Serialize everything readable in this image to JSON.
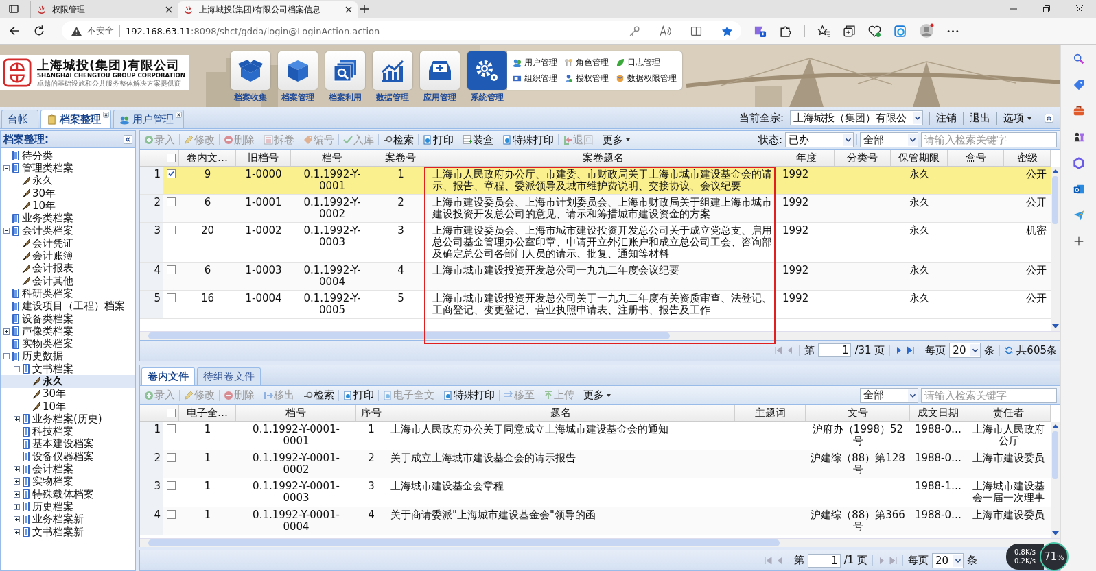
{
  "browser": {
    "tabs": [
      {
        "title": "权限管理",
        "selected": false
      },
      {
        "title": "上海城投(集团)有限公司档案信息",
        "selected": true
      }
    ],
    "security": "不安全",
    "url_host": "192.168.63.11",
    "url_path": ":8098/shct/gdda/login@LoginAction.action"
  },
  "header": {
    "company": "上海城投(集团)有限公司",
    "company_en": "SHANGHAI CHENGTOU GROUP CORPORATION",
    "slogan": "卓越的基础设施和公共服务整体解决方案提供商",
    "modules": [
      {
        "label": "档案收集",
        "kind": "open-box",
        "selected": false
      },
      {
        "label": "档案管理",
        "kind": "box",
        "selected": false
      },
      {
        "label": "档案利用",
        "kind": "search",
        "selected": false
      },
      {
        "label": "数据管理",
        "kind": "chart",
        "selected": false
      },
      {
        "label": "应用管理",
        "kind": "tray",
        "selected": false
      },
      {
        "label": "系统管理",
        "kind": "gear",
        "selected": true
      }
    ],
    "submenu": [
      {
        "label": "用户管理",
        "kind": "users"
      },
      {
        "label": "角色管理",
        "kind": "keys"
      },
      {
        "label": "日志管理",
        "kind": "leaf"
      },
      {
        "label": "组织管理",
        "kind": "card"
      },
      {
        "label": "授权管理",
        "kind": "person"
      },
      {
        "label": "数据权限管理",
        "kind": "cube"
      }
    ]
  },
  "app_tabs": [
    {
      "label": "台帐",
      "closable": false,
      "selected": false
    },
    {
      "label": "档案整理",
      "closable": true,
      "selected": true
    },
    {
      "label": "用户管理",
      "closable": true,
      "selected": false
    }
  ],
  "fonds": {
    "label": "当前全宗:",
    "value": "上海城投（集团）有限公"
  },
  "top_links": [
    "注销",
    "退出"
  ],
  "options": "选项",
  "tree": {
    "title": "档案整理:",
    "items": [
      {
        "label": "待分类",
        "kind": "category",
        "selected": false
      },
      {
        "label": "管理类档案",
        "kind": "category",
        "expanded": true,
        "selected": false,
        "children": [
          {
            "label": "永久",
            "kind": "term",
            "selected": false
          },
          {
            "label": "30年",
            "kind": "term",
            "selected": false
          },
          {
            "label": "10年",
            "kind": "term",
            "selected": false
          }
        ]
      },
      {
        "label": "业务类档案",
        "kind": "category",
        "selected": false
      },
      {
        "label": "会计类档案",
        "kind": "category",
        "expanded": true,
        "selected": false,
        "children": [
          {
            "label": "会计凭证",
            "kind": "term",
            "selected": false
          },
          {
            "label": "会计账簿",
            "kind": "term",
            "selected": false
          },
          {
            "label": "会计报表",
            "kind": "term",
            "selected": false
          },
          {
            "label": "会计其他",
            "kind": "term",
            "selected": false
          }
        ]
      },
      {
        "label": "科研类档案",
        "kind": "category",
        "selected": false
      },
      {
        "label": "建设项目（工程）档案",
        "kind": "category",
        "selected": false
      },
      {
        "label": "设备类档案",
        "kind": "category",
        "selected": false
      },
      {
        "label": "声像类档案",
        "kind": "category",
        "expanded": false,
        "selected": false
      },
      {
        "label": "实物类档案",
        "kind": "category",
        "selected": false
      },
      {
        "label": "历史数据",
        "kind": "category",
        "expanded": true,
        "selected": false,
        "children": [
          {
            "label": "文书档案",
            "kind": "category",
            "expanded": true,
            "selected": false,
            "children": [
              {
                "label": "永久",
                "kind": "term",
                "selected": true
              },
              {
                "label": "30年",
                "kind": "term",
                "selected": false
              },
              {
                "label": "10年",
                "kind": "term",
                "selected": false
              }
            ]
          },
          {
            "label": "业务档案(历史)",
            "kind": "category",
            "expanded": false,
            "selected": false
          },
          {
            "label": "科技档案",
            "kind": "category",
            "selected": false
          },
          {
            "label": "基本建设档案",
            "kind": "category",
            "selected": false
          },
          {
            "label": "设备仪器档案",
            "kind": "category",
            "selected": false
          },
          {
            "label": "会计档案",
            "kind": "category",
            "expanded": false,
            "selected": false
          },
          {
            "label": "实物档案",
            "kind": "category",
            "expanded": false,
            "selected": false
          },
          {
            "label": "特殊载体档案",
            "kind": "category",
            "expanded": false,
            "selected": false
          },
          {
            "label": "历史档案",
            "kind": "category",
            "expanded": false,
            "selected": false
          },
          {
            "label": "业务档案新",
            "kind": "category",
            "expanded": false,
            "selected": false
          },
          {
            "label": "文书档案新",
            "kind": "category",
            "expanded": false,
            "selected": false
          }
        ]
      }
    ]
  },
  "upper": {
    "toolbar": [
      {
        "label": "录入",
        "kind": "add",
        "disabled": true
      },
      {
        "label": "修改",
        "kind": "edit",
        "disabled": true
      },
      {
        "label": "删除",
        "kind": "delete",
        "disabled": true
      },
      {
        "label": "拆卷",
        "kind": "split",
        "disabled": true
      },
      {
        "label": "编号",
        "kind": "number",
        "disabled": true
      },
      {
        "label": "入库",
        "kind": "stock",
        "disabled": true
      },
      {
        "label": "检索",
        "kind": "search",
        "disabled": false
      },
      {
        "label": "打印",
        "kind": "print",
        "disabled": false
      },
      {
        "label": "装盒",
        "kind": "box",
        "disabled": false
      },
      {
        "label": "特殊打印",
        "kind": "print",
        "disabled": false
      },
      {
        "label": "退回",
        "kind": "return",
        "disabled": true
      },
      {
        "label": "更多",
        "kind": "menu",
        "disabled": false
      }
    ],
    "status_label": "状态:",
    "status": "已办",
    "scope": "全部",
    "search_placeholder": "请输入检索关键字",
    "all_checked": false,
    "columns": [
      "卷内文…",
      "旧档号",
      "档号",
      "案卷号",
      "案卷题名",
      "年度",
      "分类号",
      "保管期限",
      "盒号",
      "密级"
    ],
    "rows": [
      {
        "n": "1",
        "checked": true,
        "selected": true,
        "count": "9",
        "old_no": "1-0000",
        "file_no": "0.1.1992-Y-0001",
        "vol_no": "1",
        "title": "上海市人民政府办公厅、市建委、市财政局关于上海市城市建设基金会的请示、报告、章程、委派领导及城市维护费说明、交接协议、会议纪要",
        "year": "1992",
        "retention": "永久",
        "secrecy": "公开"
      },
      {
        "n": "2",
        "checked": false,
        "selected": false,
        "count": "6",
        "old_no": "1-0001",
        "file_no": "0.1.1992-Y-0002",
        "vol_no": "2",
        "title": "上海市建设委员会、上海市计划委员会、上海市财政局关于组建上海市城市建设投资开发总公司的意见、请示和筹措城市建设资金的方案",
        "year": "1992",
        "retention": "永久",
        "secrecy": "公开"
      },
      {
        "n": "3",
        "checked": false,
        "selected": false,
        "count": "20",
        "old_no": "1-0002",
        "file_no": "0.1.1992-Y-0003",
        "vol_no": "3",
        "title": "上海市建设委员会、上海市城市建设投资开发总公司关于成立党总支、启用总公司基金管理办公室印章、申请开立外汇账户和成立总公司工会、咨询部及确定总公司各部门人员的请示、批复、通知等材料",
        "year": "1992",
        "retention": "永久",
        "secrecy": "机密"
      },
      {
        "n": "4",
        "checked": false,
        "selected": false,
        "count": "6",
        "old_no": "1-0003",
        "file_no": "0.1.1992-Y-0004",
        "vol_no": "4",
        "title": "上海市城市建设投资开发总公司一九九二年度会议纪要",
        "year": "1992",
        "retention": "永久",
        "secrecy": "公开"
      },
      {
        "n": "5",
        "checked": false,
        "selected": false,
        "count": "16",
        "old_no": "1-0004",
        "file_no": "0.1.1992-Y-0005",
        "vol_no": "5",
        "title": "上海市城市建设投资开发总公司关于一九九二年度有关资质审查、法登记、工商登记、变更登记、营业执照申请表、注册书、报告及工作",
        "year": "1992",
        "retention": "永久",
        "secrecy": "公开"
      }
    ],
    "pager": {
      "page_label": "第",
      "page": "1",
      "total_pages": "/31 页",
      "per_page_label": "每页",
      "per_page": "20",
      "unit": "条",
      "total": "共605条"
    }
  },
  "lower": {
    "tabs": [
      {
        "label": "卷内文件",
        "selected": true
      },
      {
        "label": "待组卷文件",
        "selected": false
      }
    ],
    "toolbar": [
      {
        "label": "录入",
        "kind": "add",
        "disabled": true
      },
      {
        "label": "修改",
        "kind": "edit",
        "disabled": true
      },
      {
        "label": "删除",
        "kind": "delete",
        "disabled": true
      },
      {
        "label": "移出",
        "kind": "move-out",
        "disabled": true
      },
      {
        "label": "检索",
        "kind": "search",
        "disabled": false
      },
      {
        "label": "打印",
        "kind": "print",
        "disabled": false
      },
      {
        "label": "电子全文",
        "kind": "fulltext",
        "disabled": true
      },
      {
        "label": "特殊打印",
        "kind": "print",
        "disabled": false
      },
      {
        "label": "移至",
        "kind": "move-to",
        "disabled": true
      },
      {
        "label": "上传",
        "kind": "upload",
        "disabled": true
      },
      {
        "label": "更多",
        "kind": "menu",
        "disabled": false
      }
    ],
    "scope": "全部",
    "search_placeholder": "请输入检索关键字",
    "all_checked": false,
    "columns": [
      "电子全…",
      "档号",
      "序号",
      "题名",
      "主题词",
      "文号",
      "成文日期",
      "责任者"
    ],
    "rows": [
      {
        "n": "1",
        "checked": false,
        "selected": false,
        "efile": "1",
        "file_no": "0.1.1992-Y-0001-0001",
        "seq": "1",
        "title": "上海市人民政府办公关于同意成立上海城市建设基金会的通知",
        "doc_no": "沪府办（1998）52号",
        "date": "1988-0…",
        "author": "上海市人民政府公厅"
      },
      {
        "n": "2",
        "checked": false,
        "selected": false,
        "efile": "1",
        "file_no": "0.1.1992-Y-0001-0002",
        "seq": "2",
        "title": "关于成立上海城市建设基金会的请示报告",
        "doc_no": "沪建综（88）第128号",
        "date": "1988-0…",
        "author": "上海市建设委员"
      },
      {
        "n": "3",
        "checked": false,
        "selected": false,
        "efile": "1",
        "file_no": "0.1.1992-Y-0001-0003",
        "seq": "3",
        "title": "上海城市建设基金会章程",
        "date": "1988-1…",
        "author": "上海城市建设基会一届一次理事"
      },
      {
        "n": "4",
        "checked": false,
        "selected": false,
        "efile": "1",
        "file_no": "0.1.1992-Y-0001-0004",
        "seq": "4",
        "title": "关于商请委派\"上海城市建设基金会\"领导的函",
        "doc_no": "沪建综（88）第366号",
        "date": "1988-0…",
        "author": "上海市建设委员"
      }
    ],
    "pager": {
      "page_label": "第",
      "page": "1",
      "total_pages": "/1 页",
      "per_page_label": "每页",
      "per_page": "20",
      "unit": "条"
    }
  },
  "net_widget": {
    "up": "0.8K/s",
    "down": "0.2K/s",
    "percent": "71",
    "unit": "%"
  }
}
